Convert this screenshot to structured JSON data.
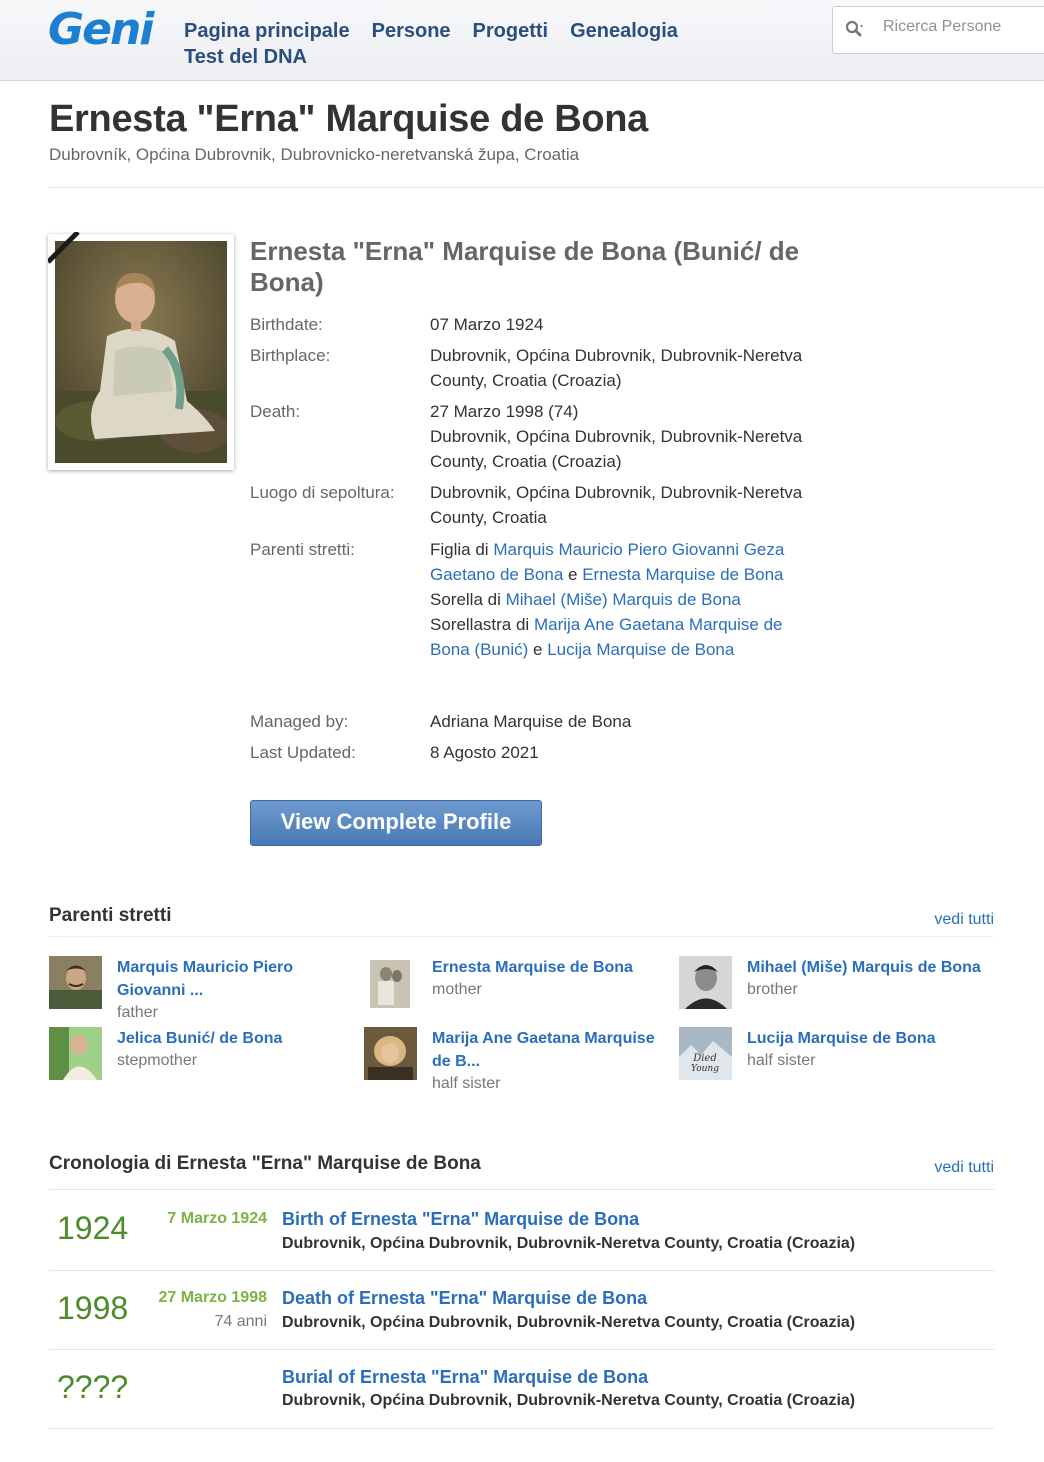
{
  "header": {
    "logo": "Geni",
    "nav": [
      "Pagina principale",
      "Persone",
      "Progetti",
      "Genealogia",
      "Test del DNA"
    ],
    "search_placeholder": "Ricerca Persone"
  },
  "page": {
    "title": "Ernesta \"Erna\" Marquise de Bona",
    "subtitle": "Dubrovník, Općina Dubrovnik, Dubrovnicko-neretvanská župa, Croatia"
  },
  "profile": {
    "full_name": "Ernesta \"Erna\" Marquise de Bona (Bunić/ de Bona)",
    "birthdate_label": "Birthdate:",
    "birthdate": "07 Marzo 1924",
    "birthplace_label": "Birthplace:",
    "birthplace": "Dubrovnik, Općina Dubrovnik, Dubrovnik-Neretva County, Croatia (Croazia)",
    "death_label": "Death:",
    "death_date": "27 Marzo 1998 (74)",
    "death_place": "Dubrovnik, Općina Dubrovnik, Dubrovnik-Neretva County, Croatia (Croazia)",
    "burial_label": "Luogo di sepoltura:",
    "burial": "Dubrovnik, Općina Dubrovnik, Dubrovnik-Neretva County, Croatia",
    "relatives_label": "Parenti stretti:",
    "relatives": {
      "daughter_of": "Figlia di",
      "father": "Marquis Mauricio Piero Giovanni Geza Gaetano de Bona",
      "and1": "e",
      "mother": "Ernesta Marquise de Bona",
      "sister_of": "Sorella di",
      "brother": "Mihael (Miše) Marquis de Bona",
      "half_sister_of": "Sorellastra di",
      "half_sister1": "Marija Ane Gaetana Marquise de Bona (Bunić)",
      "and2": "e",
      "half_sister2": "Lucija Marquise de Bona"
    },
    "managed_by_label": "Managed by:",
    "managed_by": "Adriana Marquise de Bona",
    "last_updated_label": "Last Updated:",
    "last_updated": "8 Agosto 2021",
    "button": "View Complete Profile"
  },
  "immediate_family": {
    "title": "Parenti stretti",
    "see_all": "vedi tutti",
    "members": [
      {
        "name": "Marquis Mauricio Piero Giovanni ...",
        "relation": "father"
      },
      {
        "name": "Ernesta Marquise de Bona",
        "relation": "mother"
      },
      {
        "name": "Mihael (Miše) Marquis de Bona",
        "relation": "brother"
      },
      {
        "name": "Jelica Bunić/ de Bona",
        "relation": "stepmother"
      },
      {
        "name": "Marija Ane Gaetana Marquise de B...",
        "relation": "half sister"
      },
      {
        "name": "Lucija Marquise de Bona",
        "relation": "half sister",
        "thumb_text": "Died Young"
      }
    ]
  },
  "timeline": {
    "title": "Cronologia di Ernesta \"Erna\" Marquise de Bona",
    "see_all": "vedi tutti",
    "events": [
      {
        "year": "1924",
        "date": "7 Marzo 1924",
        "age": "",
        "event": "Birth of Ernesta \"Erna\" Marquise de Bona",
        "place": "Dubrovnik, Općina Dubrovnik, Dubrovnik-Neretva County, Croatia (Croazia)"
      },
      {
        "year": "1998",
        "date": "27 Marzo 1998",
        "age": "74 anni",
        "event": "Death of Ernesta \"Erna\" Marquise de Bona",
        "place": "Dubrovnik, Općina Dubrovnik, Dubrovnik-Neretva County, Croatia (Croazia)"
      },
      {
        "year": "????",
        "date": "",
        "age": "",
        "event": "Burial of Ernesta \"Erna\" Marquise de Bona",
        "place": "Dubrovnik, Općina Dubrovnik, Dubrovnik-Neretva County, Croatia (Croazia)"
      }
    ]
  }
}
